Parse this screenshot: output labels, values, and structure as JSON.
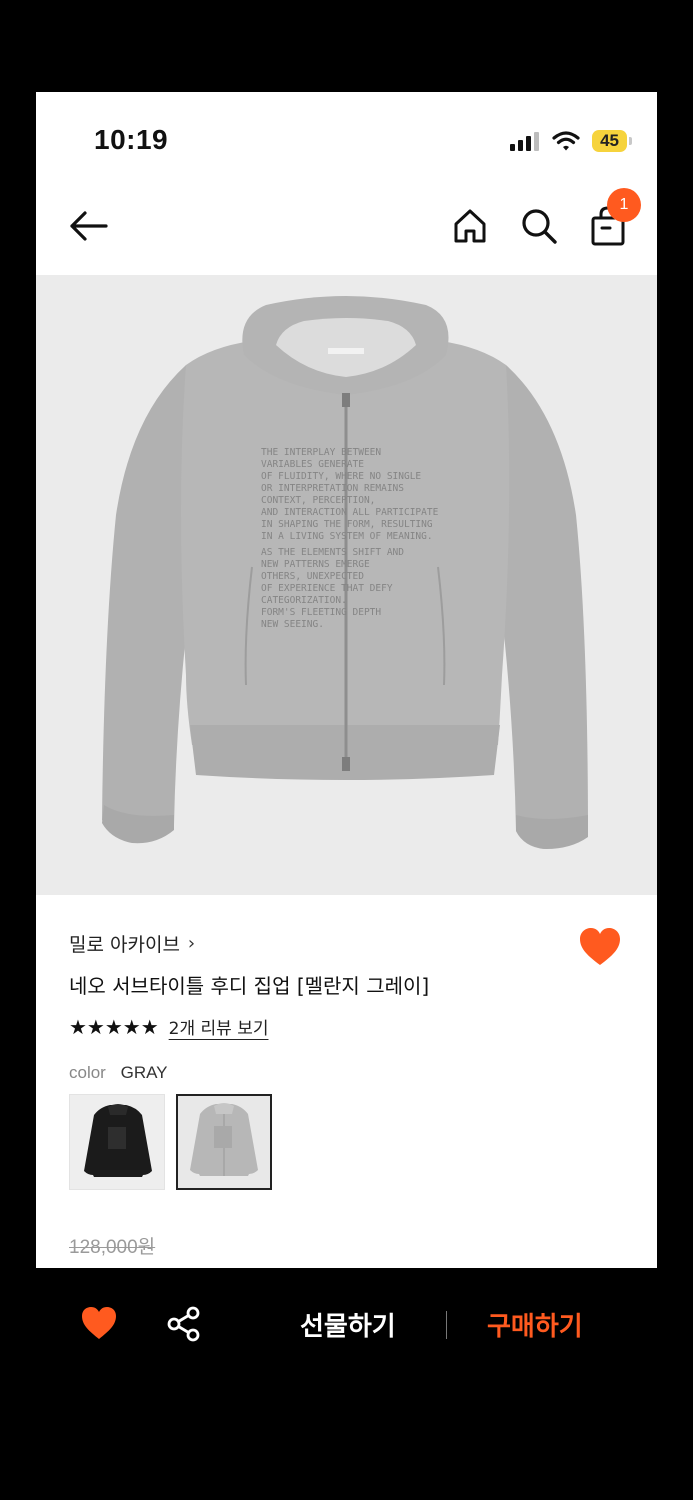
{
  "status_bar": {
    "time": "10:19",
    "battery": "45"
  },
  "header": {
    "cart_count": "1"
  },
  "product": {
    "brand": "밀로 아카이브",
    "title": "네오 서브타이틀 후디 집업 [멜란지 그레이]",
    "rating_stars": "★★★★★",
    "review_link": "2개 리뷰 보기",
    "color_label": "color",
    "color_value": "GRAY",
    "original_price": "128,000원",
    "hoodie_print_text": [
      "THE INTERPLAY BETWEEN",
      "VARIABLES GENERATE",
      "OF FLUIDITY, WHERE NO SINGLE",
      "OR INTERPRETATION REMAINS",
      "CONTEXT, PERCEPTION,",
      "AND INTERACTION ALL PARTICIPATE",
      "IN SHAPING THE FORM, RESULTING",
      "IN A LIVING SYSTEM OF MEANING.",
      "AS THE ELEMENTS SHIFT AND",
      "NEW PATTERNS EMERGE",
      "OTHERS, UNEXPECTED",
      "OF EXPERIENCE THAT DEFY",
      "CATEGORIZATION.",
      "FORM'S FLEETING DEPTH",
      "NEW SEEING."
    ]
  },
  "bottom_bar": {
    "gift_label": "선물하기",
    "buy_label": "구매하기"
  },
  "colors": {
    "accent": "#ff5a1f",
    "heather_gray": "#b3b3b3",
    "background": "#000000"
  }
}
